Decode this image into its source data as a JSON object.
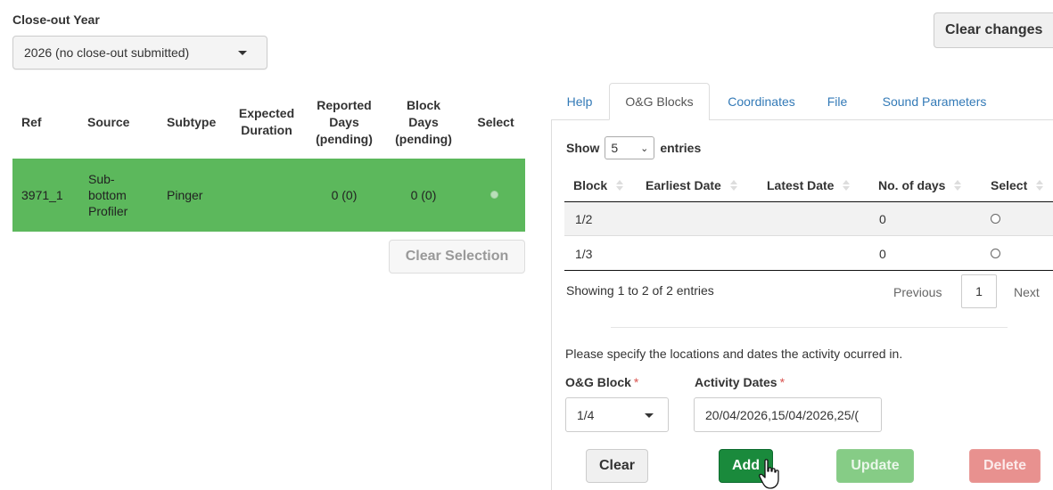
{
  "closeout": {
    "label": "Close-out Year",
    "selected": "2026 (no close-out submitted)"
  },
  "header_buttons": {
    "clear_changes": "Clear changes"
  },
  "left_table": {
    "headers": {
      "ref": "Ref",
      "source": "Source",
      "subtype": "Subtype",
      "expected_1": "Expected",
      "expected_2": "Duration",
      "reported_1": "Reported",
      "reported_2": "Days",
      "reported_3": "(pending)",
      "block_1": "Block",
      "block_2": "Days",
      "block_3": "(pending)",
      "select": "Select"
    },
    "row": {
      "ref": "3971_1",
      "source_1": "Sub-",
      "source_2": "bottom",
      "source_3": "Profiler",
      "subtype": "Pinger",
      "expected": "",
      "reported": "0 (0)",
      "block_days": "0 (0)"
    },
    "clear_selection": "Clear Selection"
  },
  "tabs": [
    {
      "label": "Help"
    },
    {
      "label": "O&G Blocks"
    },
    {
      "label": "Coordinates"
    },
    {
      "label": "File"
    },
    {
      "label": "Sound Parameters"
    }
  ],
  "datatable": {
    "show_label": "Show",
    "entries_value": "5",
    "entries_label": "entries",
    "headers": {
      "block": "Block",
      "earliest": "Earliest Date",
      "latest": "Latest Date",
      "days": "No. of days",
      "select": "Select"
    },
    "rows": [
      {
        "block": "1/2",
        "earliest": "",
        "latest": "",
        "days": "0"
      },
      {
        "block": "1/3",
        "earliest": "",
        "latest": "",
        "days": "0"
      }
    ],
    "info": "Showing 1 to 2 of 2 entries",
    "pagination": {
      "previous": "Previous",
      "page": "1",
      "next": "Next"
    }
  },
  "form": {
    "instruction": "Please specify the locations and dates the activity ocurred in.",
    "og_block_label": "O&G Block",
    "og_block_value": "1/4",
    "activity_dates_label": "Activity Dates",
    "activity_dates_value": "20/04/2026,15/04/2026,25/(",
    "required_mark": "*"
  },
  "action_buttons": {
    "clear": "Clear",
    "add": "Add",
    "update": "Update",
    "delete": "Delete"
  },
  "colors": {
    "selected_row": "#5cb85c",
    "add": "#1a8a3c",
    "update": "#86cc86",
    "delete": "#e8918f",
    "link": "#337ab7"
  }
}
